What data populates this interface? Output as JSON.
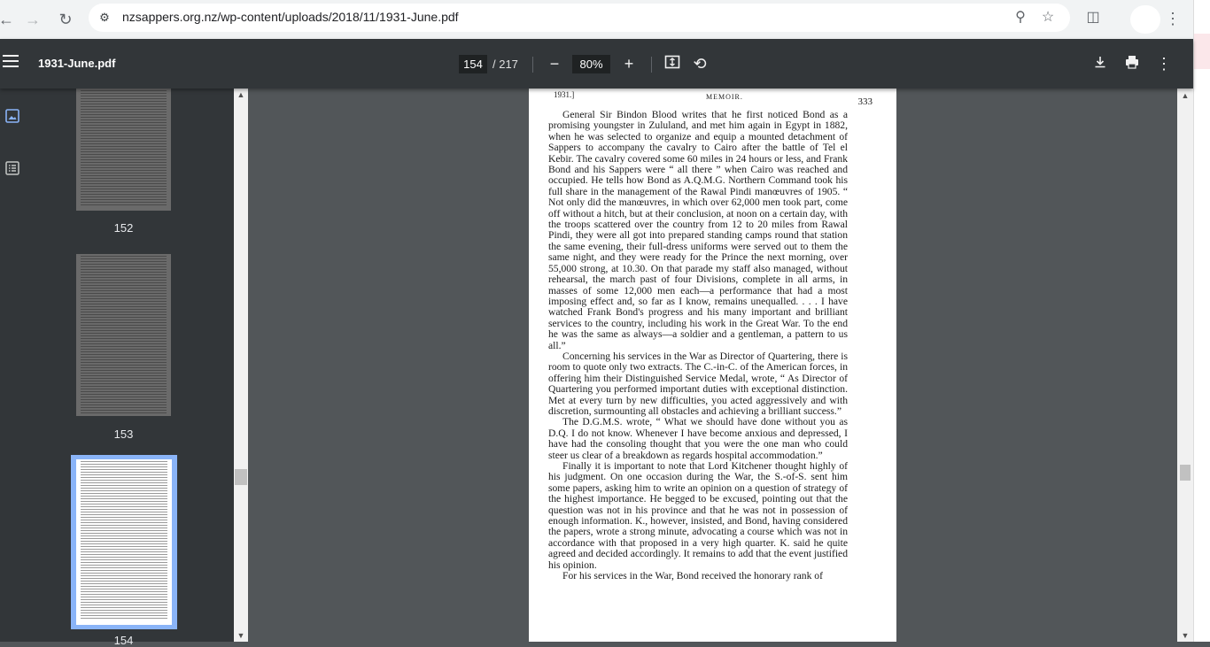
{
  "browser": {
    "url": "nzsappers.org.nz/wp-content/uploads/2018/11/1931-June.pdf"
  },
  "viewer": {
    "title": "1931-June.pdf",
    "current_page": "154",
    "total_pages": "/ 217",
    "zoom": "80%"
  },
  "thumbnails": [
    {
      "label": "152"
    },
    {
      "label": "153"
    },
    {
      "label": "154"
    }
  ],
  "page": {
    "header_year": "1931.]",
    "header_title": "MEMOIR.",
    "header_number": "333",
    "paragraphs": [
      "General Sir Bindon Blood writes that he first noticed Bond as a promising youngster in Zululand, and met him again in Egypt in 1882, when he was selected to organize and equip a mounted detachment of Sappers to accompany the cavalry to Cairo after the battle of Tel el Kebir. The cavalry covered some 60 miles in 24 hours or less, and Frank Bond and his Sappers were “ all there ” when Cairo was reached and occupied. He tells how Bond as A.Q.M.G. Northern Command took his full share in the management of the Rawal Pindi manœuvres of 1905. “ Not only did the manœuvres, in which over 62,000 men took part, come off without a hitch, but at their conclusion, at noon on a certain day, with the troops scattered over the country from 12 to 20 miles from Rawal Pindi, they were all got into prepared standing camps round that station the same evening, their full-dress uniforms were served out to them the same night, and they were ready for the Prince the next morning, over 55,000 strong, at 10.30. On that parade my staff also managed, without rehearsal, the march past of four Divisions, complete in all arms, in masses of some 12,000 men each—a performance that had a most imposing effect and, so far as I know, remains unequalled. . . . I have watched Frank Bond's progress and his many important and brilliant services to the country, including his work in the Great War. To the end he was the same as always—a soldier and a gentleman, a pattern to us all.”",
      "Concerning his services in the War as Director of Quartering, there is room to quote only two extracts. The C.-in-C. of the American forces, in offering him their Distinguished Service Medal, wrote, “ As Director of Quartering you performed important duties with exceptional distinction. Met at every turn by new difficulties, you acted aggressively and with discretion, surmounting all obstacles and achieving a brilliant success.”",
      "The D.G.M.S. wrote, “ What we should have done without you as D.Q. I do not know. Whenever I have become anxious and depressed, I have had the consoling thought that you were the one man who could steer us clear of a breakdown as regards hospital accommodation.”",
      "Finally it is important to note that Lord Kitchener thought highly of his judgment. On one occasion during the War, the S.-of-S. sent him some papers, asking him to write an opinion on a question of strategy of the highest importance. He begged to be excused, pointing out that the question was not in his province and that he was not in possession of enough information. K., however, insisted, and Bond, having considered the papers, wrote a strong minute, advocating a course which was not in accordance with that proposed in a very high quarter. K. said he quite agreed and decided accordingly. It remains to add that the event justified his opinion.",
      "For his services in the War, Bond received the honorary rank of"
    ]
  }
}
